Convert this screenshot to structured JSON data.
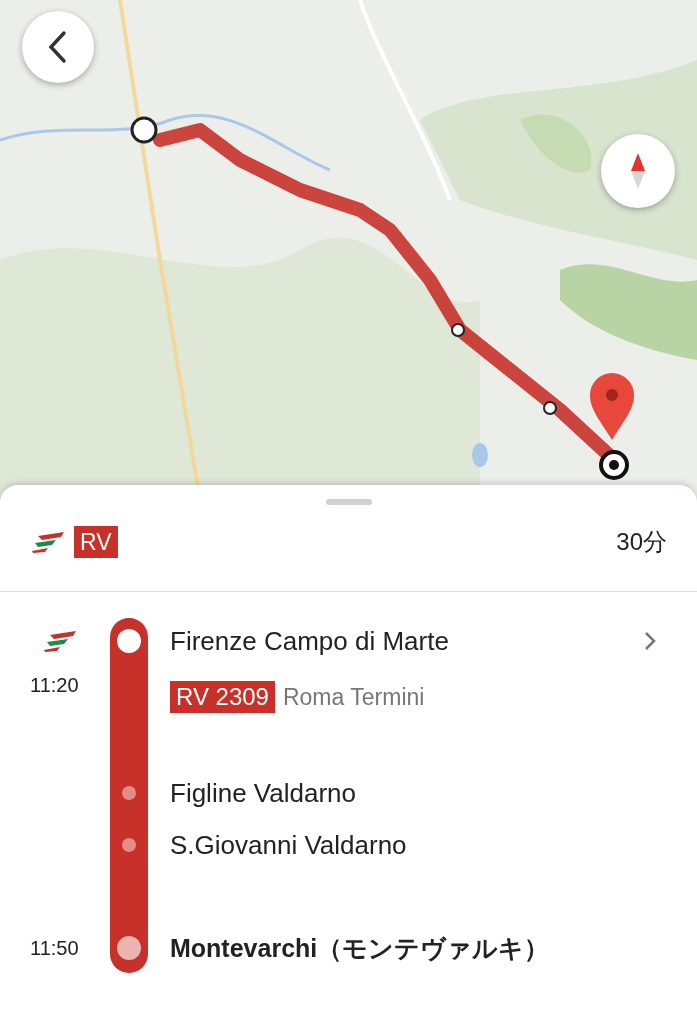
{
  "summary": {
    "badge": "RV",
    "duration": "30分"
  },
  "trip": {
    "departure": {
      "time": "11:20",
      "station": "Firenze Campo di Marte"
    },
    "train": {
      "badge": "RV 2309",
      "destination": "Roma Termini"
    },
    "stops": [
      {
        "station": "Figline Valdarno"
      },
      {
        "station": "S.Giovanni Valdarno"
      }
    ],
    "arrival": {
      "time": "11:50",
      "station": "Montevarchi（モンテヴァルキ）"
    }
  }
}
